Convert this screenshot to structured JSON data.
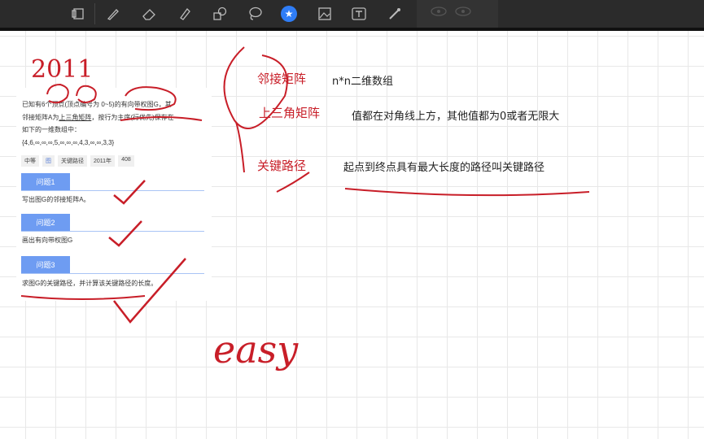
{
  "toolbar": {
    "tools": [
      {
        "name": "pages",
        "icon": "pages-icon"
      },
      {
        "name": "pen",
        "icon": "pen-icon"
      },
      {
        "name": "eraser",
        "icon": "eraser-icon"
      },
      {
        "name": "highlighter",
        "icon": "highlighter-icon"
      },
      {
        "name": "shapes",
        "icon": "shapes-icon"
      },
      {
        "name": "lasso",
        "icon": "lasso-icon"
      },
      {
        "name": "favorite",
        "icon": "star-icon",
        "active": true
      },
      {
        "name": "image",
        "icon": "image-icon"
      },
      {
        "name": "text",
        "icon": "text-icon"
      },
      {
        "name": "laser",
        "icon": "laser-icon"
      }
    ],
    "active_color": "#2f7df6"
  },
  "card": {
    "question_line1_a": "已知有6个顶点(顶点编号为 0~5)的有向带权图G，其",
    "question_line2_a": "邻接矩阵A为",
    "question_line2_u": "上三角矩阵",
    "question_line2_b": "，按行为主序(行优先)保存在",
    "question_line3": "如下的一维数组中：",
    "question_line4": "{4,6,∞,∞,∞,5,∞,∞,∞,4,3,∞,∞,3,3}",
    "tags": [
      "中等",
      "图",
      "关键路径",
      "2011年",
      "408"
    ],
    "q1_label": "问题1",
    "q1_desc": "写出图G的邻接矩阵A。",
    "q2_label": "问题2",
    "q2_desc": "画出有向带权图G",
    "q3_label": "问题3",
    "q3_desc": "求图G的关键路径，并计算该关键路径的长度。"
  },
  "notes": {
    "handwritten_year": "2011",
    "term1": "邻接矩阵",
    "def1": "n*n二维数组",
    "term2": "上三角矩阵",
    "def2": "值都在对角线上方，其他值都为0或者无限大",
    "term3": "关键路径",
    "def3": "起点到终点具有最大长度的路径叫关键路径",
    "handwritten_easy": "easy"
  },
  "colors": {
    "ink_red": "#c81e28",
    "toolbar_bg": "#2b2b2b",
    "tab_blue": "#6e9cf2"
  }
}
